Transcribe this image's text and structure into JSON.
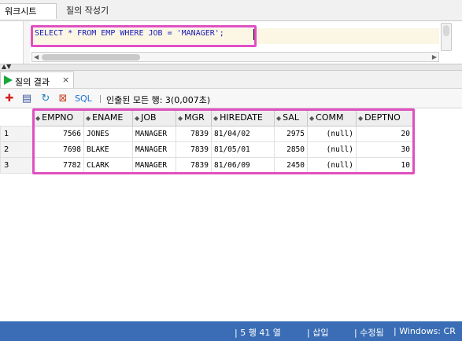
{
  "top_tabs": {
    "worksheet": "워크시트",
    "query_builder": "질의 작성기"
  },
  "editor": {
    "sql_text": "SELECT * FROM EMP WHERE JOB = 'MANAGER';"
  },
  "results_tab": {
    "label": "질의 결과",
    "close": "×"
  },
  "results_toolbar": {
    "sql_label": "SQL",
    "fetch_status": "인출된 모든 행: 3(0,007초)"
  },
  "table": {
    "columns": [
      "EMPNO",
      "ENAME",
      "JOB",
      "MGR",
      "HIREDATE",
      "SAL",
      "COMM",
      "DEPTNO"
    ],
    "rows": [
      [
        "1",
        "7566",
        "JONES",
        "MANAGER",
        "7839",
        "81/04/02",
        "2975",
        "(null)",
        "20"
      ],
      [
        "2",
        "7698",
        "BLAKE",
        "MANAGER",
        "7839",
        "81/05/01",
        "2850",
        "(null)",
        "30"
      ],
      [
        "3",
        "7782",
        "CLARK",
        "MANAGER",
        "7839",
        "81/06/09",
        "2450",
        "(null)",
        "10"
      ]
    ]
  },
  "status_bar": {
    "position": "| 5 행 41 열",
    "insert_mode": "| 삽입",
    "modified": "| 수정됨",
    "platform": "| Windows: CR"
  },
  "colors": {
    "highlight_box": "#e050c0",
    "sql_text": "#1a1ab8",
    "status_bar": "#3a6db5",
    "run_icon": "#19a83a"
  }
}
